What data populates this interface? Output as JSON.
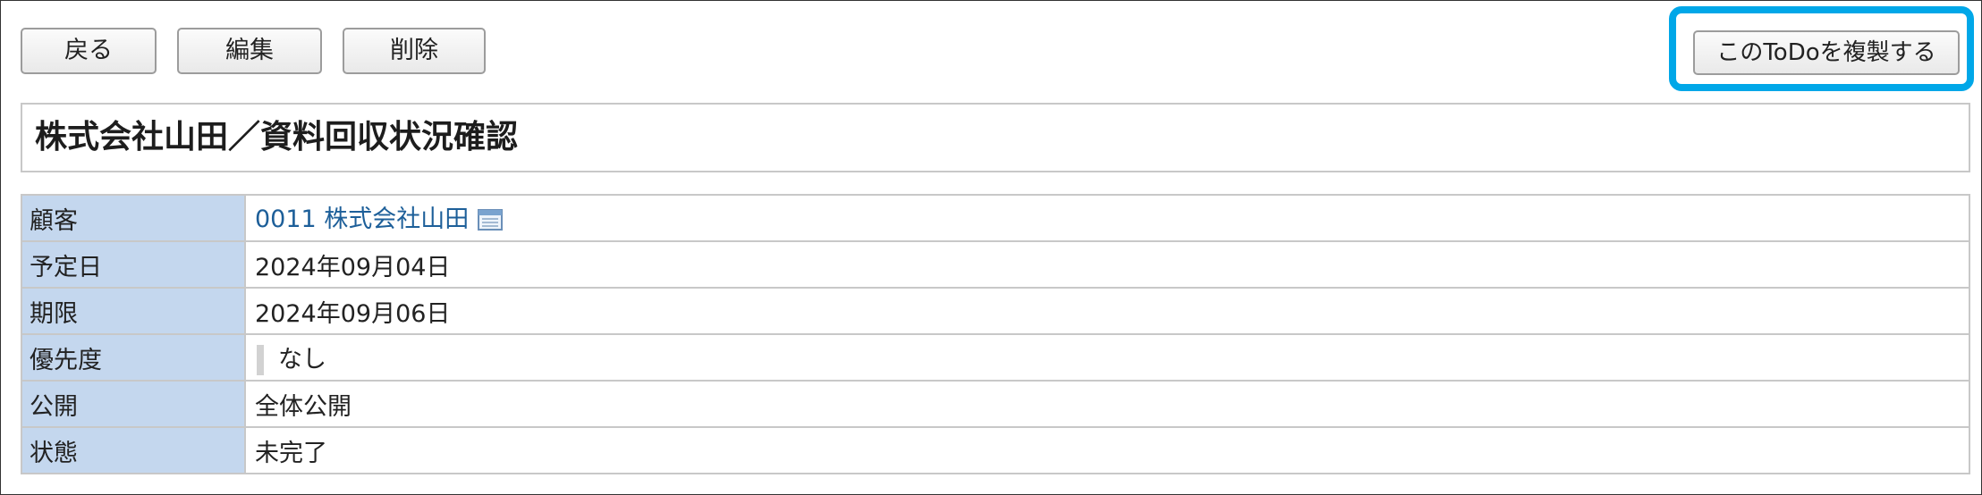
{
  "toolbar": {
    "back_label": "戻る",
    "edit_label": "編集",
    "delete_label": "削除",
    "duplicate_label": "このToDoを複製する"
  },
  "title": "株式会社山田／資料回収状況確認",
  "details": {
    "customer": {
      "label": "顧客",
      "value": "0011 株式会社山田",
      "icon": "calendar-icon"
    },
    "scheduled_date": {
      "label": "予定日",
      "value": "2024年09月04日"
    },
    "deadline": {
      "label": "期限",
      "value": "2024年09月06日"
    },
    "priority": {
      "label": "優先度",
      "value": "なし"
    },
    "visibility": {
      "label": "公開",
      "value": "全体公開"
    },
    "status": {
      "label": "状態",
      "value": "未完了"
    }
  },
  "colors": {
    "highlight": "#00a7e8",
    "label_background": "#c4d7ee",
    "link": "#1d5f99"
  }
}
